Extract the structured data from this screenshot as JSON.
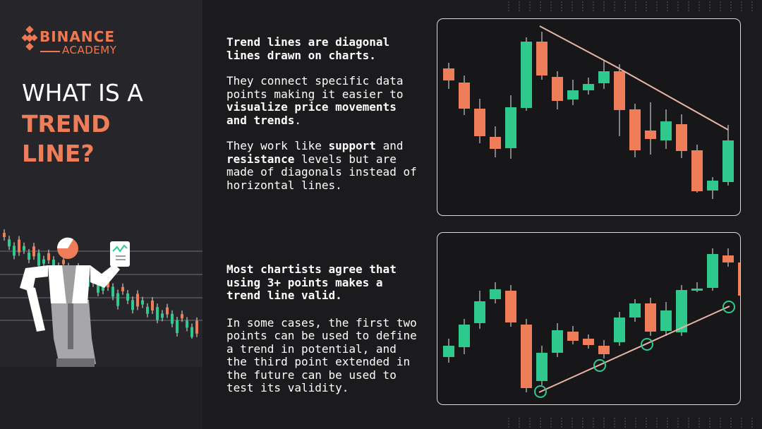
{
  "brand": {
    "name": "BINANCE",
    "sub": "ACADEMY"
  },
  "title": {
    "line1": "WHAT IS A",
    "line2": "TREND",
    "line3": "LINE?"
  },
  "section1": {
    "heading": "Trend lines are diagonal lines drawn on charts.",
    "p1_a": "They connect specific data points making it easier to ",
    "p1_b": "visualize price movements and trends",
    "p1_c": ".",
    "p2_a": "They work like ",
    "p2_b": "support",
    "p2_c": " and ",
    "p2_d": "resistance",
    "p2_e": " levels but are made of diagonals instead of horizontal lines."
  },
  "section2": {
    "heading": "Most chartists agree that using 3+ points makes a trend line valid.",
    "p1": "In some cases, the first two points can be used to define a trend in potential, and the third point extended in the future can be used to test its validity."
  },
  "colors": {
    "up": "#2fc98e",
    "down": "#ef7d5a",
    "brand": "#f07850",
    "trend": "#e9b5a6"
  }
}
